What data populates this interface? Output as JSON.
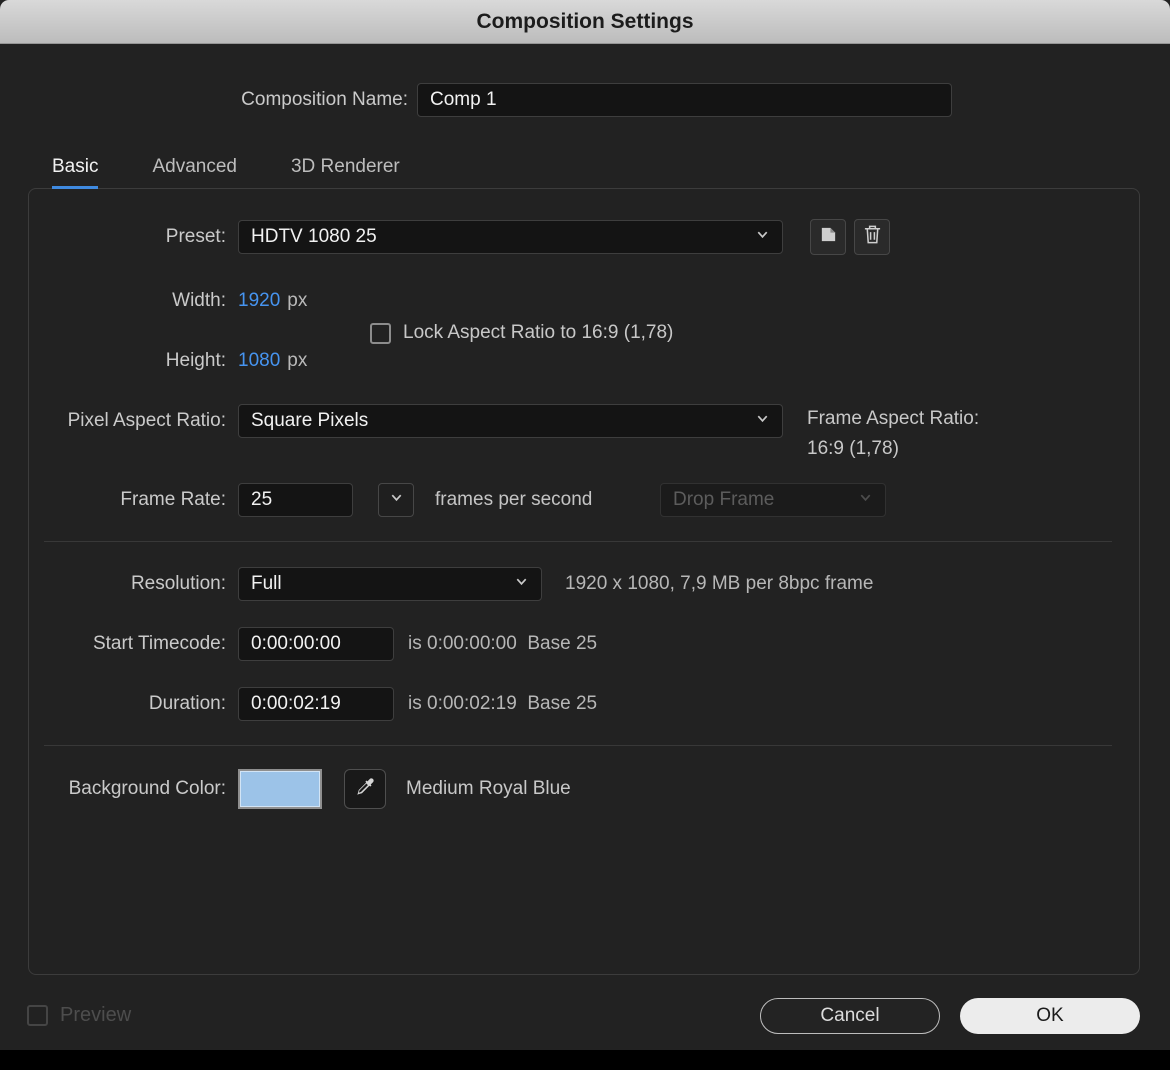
{
  "title": "Composition Settings",
  "composition_name": {
    "label": "Composition Name:",
    "value": "Comp 1"
  },
  "tabs": [
    {
      "label": "Basic"
    },
    {
      "label": "Advanced"
    },
    {
      "label": "3D Renderer"
    }
  ],
  "preset": {
    "label": "Preset:",
    "value": "HDTV 1080 25"
  },
  "dimensions": {
    "width_label": "Width:",
    "width_value": "1920",
    "width_unit": "px",
    "height_label": "Height:",
    "height_value": "1080",
    "height_unit": "px",
    "lock_label": "Lock Aspect Ratio to 16:9 (1,78)",
    "lock_checked": false
  },
  "pixel_aspect_ratio": {
    "label": "Pixel Aspect Ratio:",
    "value": "Square Pixels"
  },
  "frame_aspect_ratio": {
    "label": "Frame Aspect Ratio:",
    "value": "16:9 (1,78)"
  },
  "frame_rate": {
    "label": "Frame Rate:",
    "value": "25",
    "suffix": "frames per second",
    "drop_frame": "Drop Frame"
  },
  "resolution": {
    "label": "Resolution:",
    "value": "Full",
    "info": "1920 x 1080, 7,9 MB per 8bpc frame"
  },
  "start_timecode": {
    "label": "Start Timecode:",
    "value": "0:00:00:00",
    "info": "is 0:00:00:00  Base 25"
  },
  "duration": {
    "label": "Duration:",
    "value": "0:00:02:19",
    "info": "is 0:00:02:19  Base 25"
  },
  "background_color": {
    "label": "Background Color:",
    "hex": "#9cc3e8",
    "style": "background-color:#9cc3e8",
    "name": "Medium Royal Blue"
  },
  "footer": {
    "preview_label": "Preview",
    "cancel_label": "Cancel",
    "ok_label": "OK"
  },
  "icons": {
    "dropdowns": "chevron-down-icon",
    "new_preset": "save-preset-icon",
    "delete_preset": "trash-icon",
    "color_picker": "eyedropper-icon"
  },
  "colors": {
    "accent_blue": "#3f8ae0",
    "value_blue": "#4694f0",
    "titlebar_text": "#1c1c1c"
  }
}
